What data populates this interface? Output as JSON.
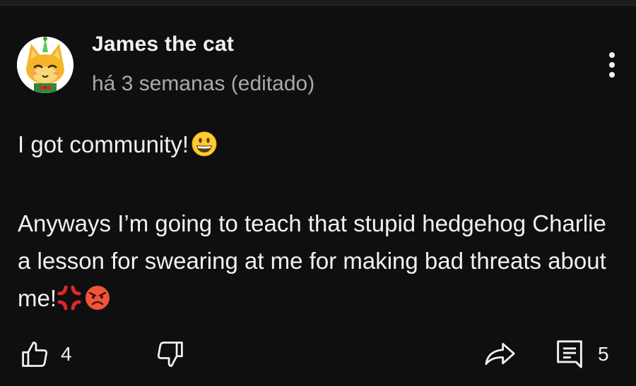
{
  "post": {
    "author": "James the cat",
    "timestamp": "há 3 semanas (editado)",
    "paragraphs": [
      "I got community!",
      "Anyways I’m going to teach that stupid hedgehog Charlie a lesson for swearing at me for making bad threats about me!"
    ],
    "emojis": {
      "p1": "grinning-face",
      "p2": [
        "anger-symbol",
        "angry-face"
      ]
    }
  },
  "actions": {
    "like_count": "4",
    "comment_count": "5"
  },
  "colors": {
    "background": "#0f0f0f",
    "text": "#f1f1f1",
    "muted": "#aaaaaa"
  }
}
